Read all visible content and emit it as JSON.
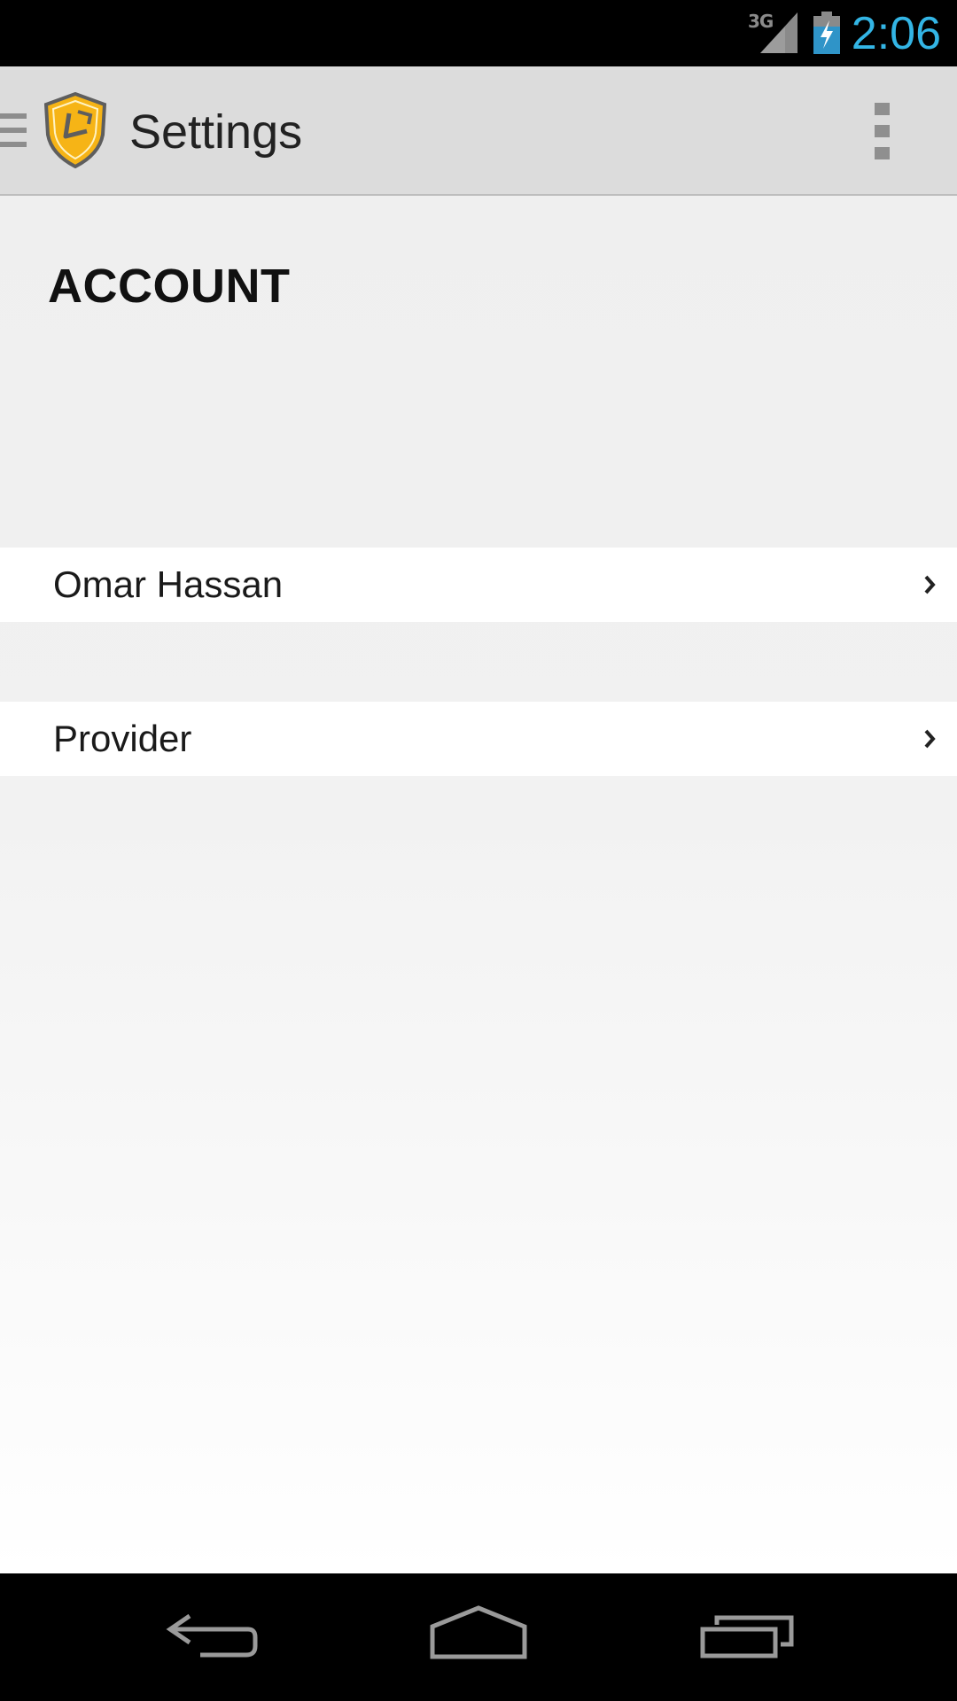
{
  "status_bar": {
    "network_type": "3G",
    "time": "2:06",
    "icons": [
      "signal-icon",
      "battery-charging-icon"
    ],
    "clock_color": "#33b5e5",
    "battery_color": "#2f94c8"
  },
  "action_bar": {
    "title": "Settings",
    "icons": [
      "drawer-icon",
      "app-shield-logo",
      "overflow-menu-icon"
    ],
    "logo_colors": [
      "#f6b416",
      "#5e5e5e"
    ]
  },
  "content": {
    "section_header": "ACCOUNT",
    "items": [
      {
        "label": "Omar Hassan",
        "icon": "chevron-right-icon"
      },
      {
        "label": "Provider",
        "icon": "chevron-right-icon"
      }
    ]
  },
  "nav_bar": {
    "buttons": [
      "back-icon",
      "home-icon",
      "recent-apps-icon"
    ]
  }
}
